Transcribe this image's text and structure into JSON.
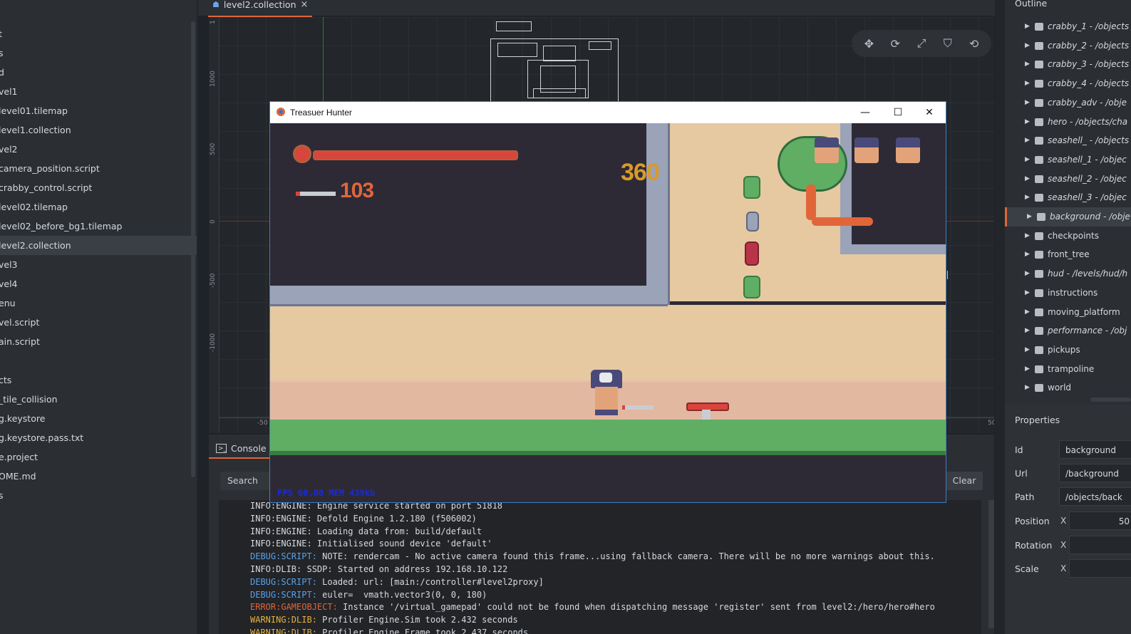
{
  "assets": {
    "items": [
      {
        "label": "t"
      },
      {
        "label": "s"
      },
      {
        "label": "d"
      },
      {
        "label": "vel1"
      },
      {
        "label": "level01.tilemap"
      },
      {
        "label": "level1.collection"
      },
      {
        "label": "vel2"
      },
      {
        "label": "camera_position.script"
      },
      {
        "label": "crabby_control.script"
      },
      {
        "label": "level02.tilemap"
      },
      {
        "label": "level02_before_bg1.tilemap"
      },
      {
        "label": "level2.collection"
      },
      {
        "label": "vel3"
      },
      {
        "label": "vel4"
      },
      {
        "label": "enu"
      },
      {
        "label": "vel.script"
      },
      {
        "label": "ain.script"
      },
      {
        "label": ""
      },
      {
        "label": "cts"
      },
      {
        "label": "_tile_collision"
      },
      {
        "label": "g.keystore"
      },
      {
        "label": "g.keystore.pass.txt"
      },
      {
        "label": "e.project"
      },
      {
        "label": "OME.md"
      },
      {
        "label": "s"
      }
    ],
    "selected_index": 11
  },
  "editor": {
    "tab_label": "level2.collection",
    "tab_close": "×",
    "ruler_ticks": [
      "1",
      "1000",
      "500",
      "0",
      "-500",
      "-1000"
    ],
    "bottom_ticks": [
      "-50",
      "50"
    ],
    "tools": [
      "move-icon",
      "rotate-icon",
      "scale-icon",
      "select-icon",
      "camera-icon"
    ]
  },
  "console": {
    "tab_label": "Console",
    "search_placeholder": "Search",
    "clear_label": "Clear",
    "lines": [
      {
        "prefix": "INFO:ENGINE:",
        "text": " Engine service started on port 51818",
        "color": "#d6d9dd"
      },
      {
        "prefix": "INFO:ENGINE:",
        "text": " Defold Engine 1.2.180 (f506002)",
        "color": "#d6d9dd"
      },
      {
        "prefix": "INFO:ENGINE:",
        "text": " Loading data from: build/default",
        "color": "#d6d9dd"
      },
      {
        "prefix": "INFO:ENGINE:",
        "text": " Initialised sound device 'default'",
        "color": "#d6d9dd"
      },
      {
        "prefix": "DEBUG:SCRIPT:",
        "text": " NOTE: rendercam - No active camera found this frame...using fallback camera. There will be no more warnings about this.",
        "color": "#5aa0e6"
      },
      {
        "prefix": "INFO:DLIB:",
        "text": " SSDP: Started on address 192.168.10.122",
        "color": "#d6d9dd"
      },
      {
        "prefix": "DEBUG:SCRIPT:",
        "text": " Loaded: url: [main:/controller#level2proxy]",
        "color": "#5aa0e6"
      },
      {
        "prefix": "DEBUG:SCRIPT:",
        "text": " euler=  vmath.vector3(0, 0, 180)",
        "color": "#5aa0e6"
      },
      {
        "prefix": "ERROR:GAMEOBJECT:",
        "text": " Instance '/virtual_gamepad' could not be found when dispatching message 'register' sent from level2:/hero/hero#hero",
        "color": "#e0663a"
      },
      {
        "prefix": "WARNING:DLIB:",
        "text": " Profiler Engine.Sim took 2.432 seconds",
        "color": "#e6b23a"
      },
      {
        "prefix": "WARNING:DLIB:",
        "text": " Profiler Engine.Frame took 2.437 seconds",
        "color": "#e6b23a"
      }
    ]
  },
  "outline": {
    "title": "Outline",
    "items": [
      {
        "label": "crabby_1 - /objects",
        "italic": true
      },
      {
        "label": "crabby_2 - /objects",
        "italic": true
      },
      {
        "label": "crabby_3 - /objects",
        "italic": true
      },
      {
        "label": "crabby_4 - /objects",
        "italic": true
      },
      {
        "label": "crabby_adv - /obje",
        "italic": true
      },
      {
        "label": "hero - /objects/cha",
        "italic": true
      },
      {
        "label": "seashell_ - /objects",
        "italic": true
      },
      {
        "label": "seashell_1 - /objec",
        "italic": true
      },
      {
        "label": "seashell_2 - /objec",
        "italic": true
      },
      {
        "label": "seashell_3 - /objec",
        "italic": true
      },
      {
        "label": "background - /obje",
        "italic": true
      },
      {
        "label": "checkpoints",
        "italic": false
      },
      {
        "label": "front_tree",
        "italic": false
      },
      {
        "label": "hud - /levels/hud/h",
        "italic": true
      },
      {
        "label": "instructions",
        "italic": false
      },
      {
        "label": "moving_platform",
        "italic": false
      },
      {
        "label": "performance - /obj",
        "italic": true
      },
      {
        "label": "pickups",
        "italic": false
      },
      {
        "label": "trampoline",
        "italic": false
      },
      {
        "label": "world",
        "italic": false
      }
    ],
    "selected_index": 10
  },
  "properties": {
    "title": "Properties",
    "id_label": "Id",
    "id_value": "background",
    "url_label": "Url",
    "url_value": "/background",
    "path_label": "Path",
    "path_value": "/objects/back",
    "position_label": "Position",
    "position_x": "50",
    "rotation_label": "Rotation",
    "rotation_x": "",
    "scale_label": "Scale",
    "scale_x": "",
    "axis_x": "X"
  },
  "game_window": {
    "title": "Treasuer Hunter",
    "minimize": "—",
    "maximize": "☐",
    "close": "✕",
    "score": "360",
    "ammo": "103",
    "fps_text": "FPS 60.00  MEM 439kb"
  },
  "colors": {
    "accent": "#e0663a",
    "sand": "#e6c9a0",
    "stone": "#9aa3b8",
    "grass": "#5fae63",
    "health": "#d8453c"
  }
}
